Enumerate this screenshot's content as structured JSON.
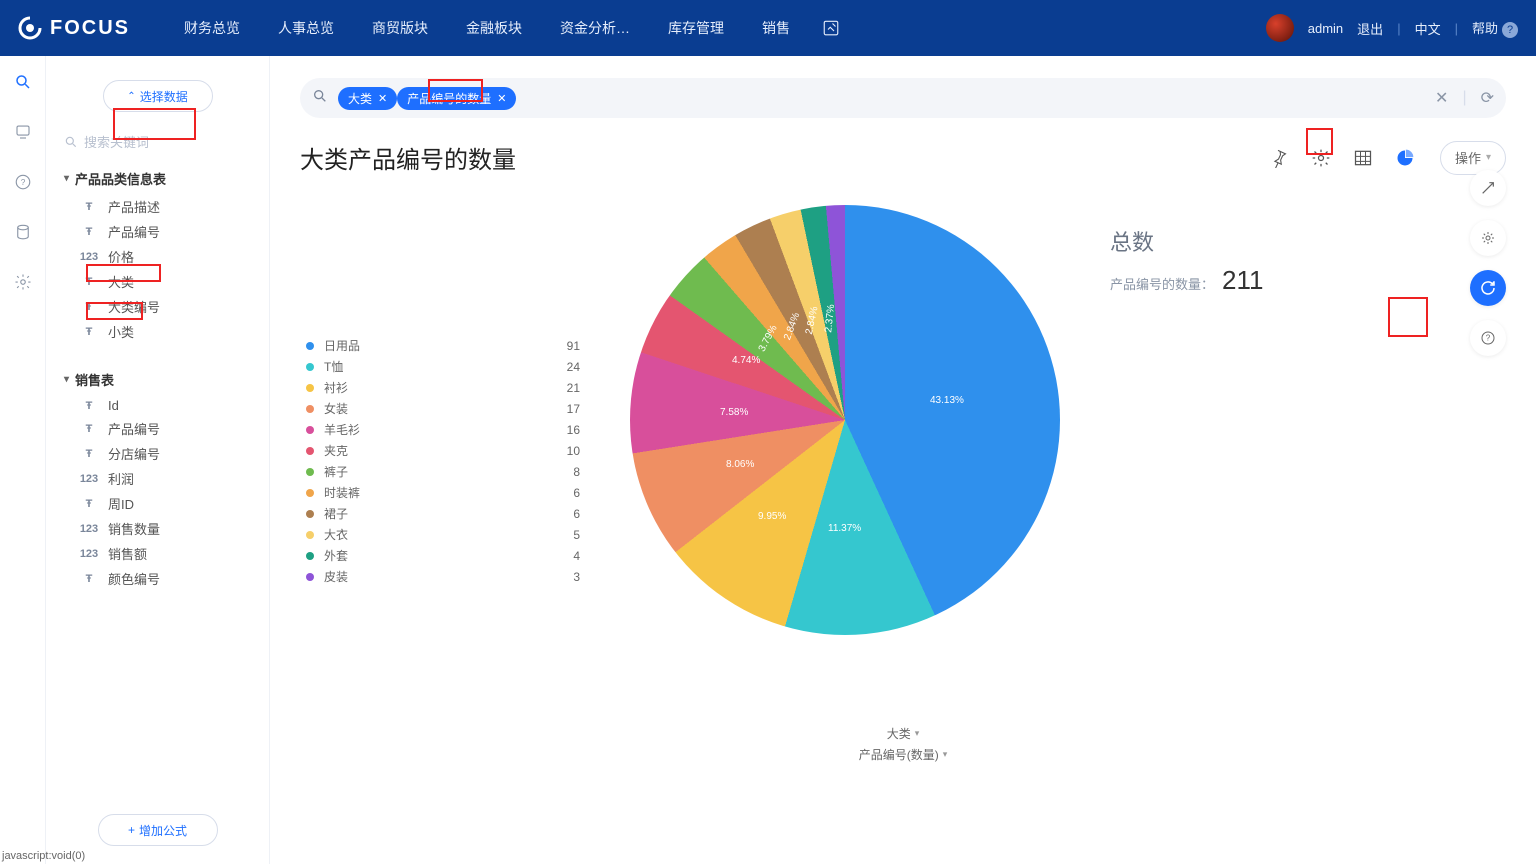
{
  "brand": "FOCUS",
  "nav": {
    "items": [
      "财务总览",
      "人事总览",
      "商贸版块",
      "金融板块",
      "资金分析…",
      "库存管理",
      "销售"
    ]
  },
  "user": {
    "name": "admin",
    "logout": "退出",
    "lang": "中文",
    "help": "帮助"
  },
  "side": {
    "select_data_btn": "选择数据",
    "search_placeholder": "搜索关键词",
    "tables": [
      {
        "name": "产品品类信息表",
        "fields": [
          {
            "icon": "T",
            "label": "产品描述"
          },
          {
            "icon": "T",
            "label": "产品编号"
          },
          {
            "icon": "123",
            "label": "价格"
          },
          {
            "icon": "T",
            "label": "大类"
          },
          {
            "icon": "T",
            "label": "大类编号"
          },
          {
            "icon": "T",
            "label": "小类"
          }
        ]
      },
      {
        "name": "销售表",
        "fields": [
          {
            "icon": "T",
            "label": "Id"
          },
          {
            "icon": "T",
            "label": "产品编号"
          },
          {
            "icon": "T",
            "label": "分店编号"
          },
          {
            "icon": "123",
            "label": "利润"
          },
          {
            "icon": "T",
            "label": "周ID"
          },
          {
            "icon": "123",
            "label": "销售数量"
          },
          {
            "icon": "123",
            "label": "销售额"
          },
          {
            "icon": "T",
            "label": "颜色编号"
          }
        ]
      }
    ],
    "add_formula_btn": "增加公式"
  },
  "query": {
    "chips": [
      "大类",
      "产品编号的数量"
    ]
  },
  "title": "大类产品编号的数量",
  "actions_btn": "操作",
  "totals": {
    "label": "总数",
    "metric_label": "产品编号的数量：",
    "value": "211"
  },
  "axis": {
    "dim": "大类",
    "measure": "产品编号(数量)"
  },
  "status": "javascript:void(0)",
  "chart_data": {
    "type": "pie",
    "title": "大类产品编号的数量",
    "series": [
      {
        "name": "日用品",
        "value": 91,
        "color": "#2f90ed",
        "pct": "43.13%"
      },
      {
        "name": "T恤",
        "value": 24,
        "color": "#35c7cf",
        "pct": "11.37%"
      },
      {
        "name": "衬衫",
        "value": 21,
        "color": "#f6c445",
        "pct": "9.95%"
      },
      {
        "name": "女装",
        "value": 17,
        "color": "#ef8f63",
        "pct": "8.06%"
      },
      {
        "name": "羊毛衫",
        "value": 16,
        "color": "#d84f9b",
        "pct": "7.58%"
      },
      {
        "name": "夹克",
        "value": 10,
        "color": "#e45570",
        "pct": "4.74%"
      },
      {
        "name": "裤子",
        "value": 8,
        "color": "#6fbb4f",
        "pct": "3.79%"
      },
      {
        "name": "时装裤",
        "value": 6,
        "color": "#f0a54a",
        "pct": "2.84%"
      },
      {
        "name": "裙子",
        "value": 6,
        "color": "#ad7f50",
        "pct": "2.84%"
      },
      {
        "name": "大衣",
        "value": 5,
        "color": "#f6cf6a",
        "pct": "2.37%"
      },
      {
        "name": "外套",
        "value": 4,
        "color": "#1ea083",
        "pct": ""
      },
      {
        "name": "皮装",
        "value": 3,
        "color": "#8e54d8",
        "pct": ""
      }
    ],
    "total": 211
  }
}
